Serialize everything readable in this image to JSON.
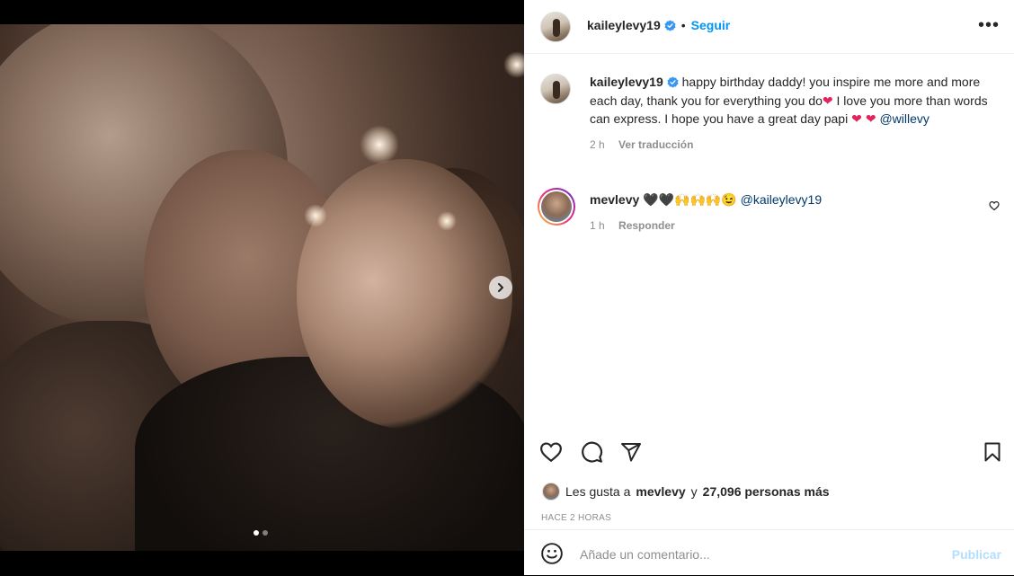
{
  "post": {
    "author": "kaileylevy19",
    "follow_label": "Seguir",
    "bullet": "•",
    "more_label": "•••",
    "caption": {
      "part1": "happy birthday daddy! you inspire me more and more each day, thank you for everything you do",
      "part2": " I love you more than words can express. I hope you have a great day papi ",
      "mention": "@willevy",
      "heart": "❤",
      "age": "2 h",
      "translate_label": "Ver traducción"
    }
  },
  "comments": [
    {
      "username": "mevlevy",
      "emojis": "🖤🖤🙌🙌🙌😉",
      "mention": "@kaileylevy19",
      "age": "1 h",
      "reply_label": "Responder"
    }
  ],
  "likes": {
    "prefix": "Les gusta a",
    "user": "mevlevy",
    "connector": "y",
    "others": "27,096 personas más"
  },
  "timestamp": "HACE 2 HORAS",
  "comment_box": {
    "placeholder": "Añade un comentario...",
    "publish_label": "Publicar"
  },
  "carousel": {
    "current": 1,
    "total": 2
  },
  "colors": {
    "accent": "#0095f6",
    "verified": "#3897f0",
    "heart": "#e0245e",
    "publish_disabled": "#b2dffc"
  },
  "icons": [
    "verified-badge-icon",
    "more-options-icon",
    "chevron-right-icon",
    "heart-icon",
    "comment-icon",
    "share-icon",
    "bookmark-icon",
    "emoji-icon"
  ]
}
